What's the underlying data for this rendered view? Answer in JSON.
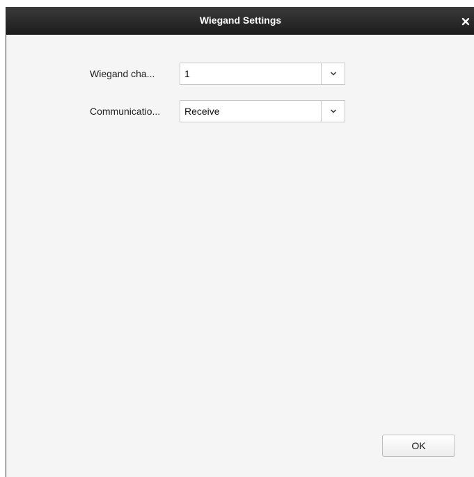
{
  "dialog": {
    "title": "Wiegand Settings",
    "close_icon": "close-icon"
  },
  "form": {
    "rows": [
      {
        "label": "Wiegand cha...",
        "value": "1"
      },
      {
        "label": "Communicatio...",
        "value": "Receive"
      }
    ],
    "dropdown_icon": "chevron-down-icon"
  },
  "footer": {
    "ok_label": "OK"
  }
}
